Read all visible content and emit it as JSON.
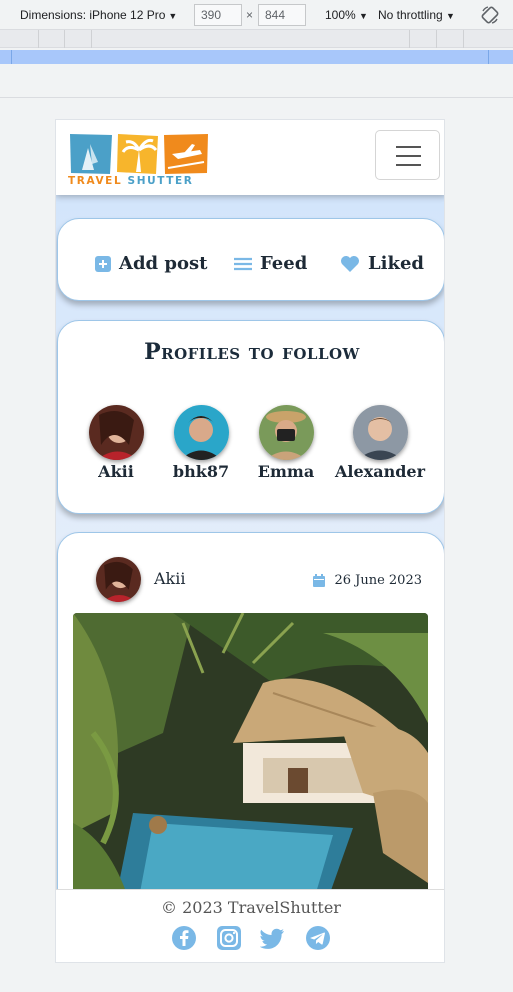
{
  "devtools": {
    "dimensions_label": "Dimensions: iPhone 12 Pro",
    "width_value": "390",
    "times": "×",
    "height_value": "844",
    "zoom": "100%",
    "throttling": "No throttling"
  },
  "brand": {
    "logo_word1": "TRAVEL",
    "logo_word2": "SHUTTER",
    "accent_orange": "#f08a1c",
    "accent_blue": "#4ba0c8"
  },
  "nav": {
    "items": [
      {
        "label": "Add post",
        "icon": "plus-square-icon"
      },
      {
        "label": "Feed",
        "icon": "list-icon"
      },
      {
        "label": "Liked",
        "icon": "heart-icon"
      }
    ]
  },
  "profiles": {
    "title": "Profiles to follow",
    "users": [
      {
        "name": "Akii"
      },
      {
        "name": "bhk87"
      },
      {
        "name": "Emma"
      },
      {
        "name": "Alexander"
      }
    ]
  },
  "post": {
    "author": "Akii",
    "date": "26 June 2023"
  },
  "footer": {
    "copyright": "© 2023 TravelShutter",
    "social": [
      "facebook-icon",
      "instagram-icon",
      "twitter-icon",
      "telegram-icon"
    ],
    "icon_color": "#7ab8e6"
  }
}
